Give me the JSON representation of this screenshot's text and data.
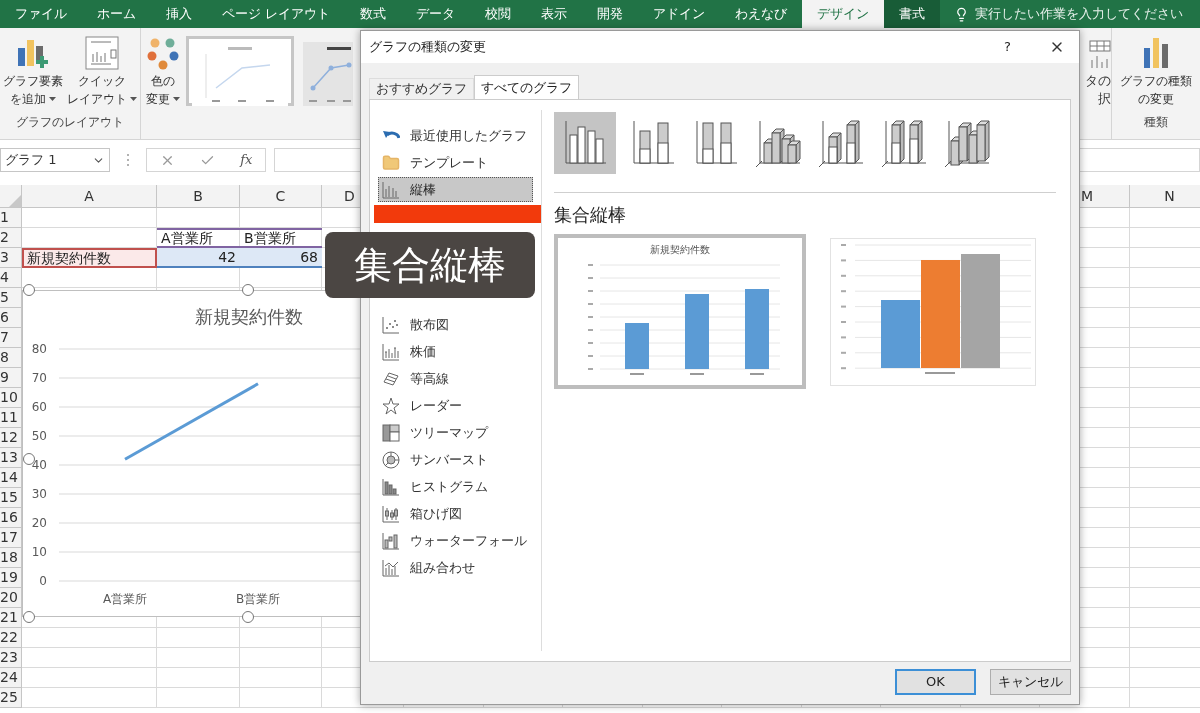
{
  "ribbon_tabs": [
    {
      "label": "ファイル",
      "kind": "normal",
      "selected": false
    },
    {
      "label": "ホーム",
      "kind": "normal",
      "selected": false
    },
    {
      "label": "挿入",
      "kind": "normal",
      "selected": false
    },
    {
      "label": "ページ レイアウト",
      "kind": "normal",
      "selected": false
    },
    {
      "label": "数式",
      "kind": "normal",
      "selected": false
    },
    {
      "label": "データ",
      "kind": "normal",
      "selected": false
    },
    {
      "label": "校閲",
      "kind": "normal",
      "selected": false
    },
    {
      "label": "表示",
      "kind": "normal",
      "selected": false
    },
    {
      "label": "開発",
      "kind": "normal",
      "selected": false
    },
    {
      "label": "アドイン",
      "kind": "normal",
      "selected": false
    },
    {
      "label": "わえなび",
      "kind": "normal",
      "selected": false
    },
    {
      "label": "デザイン",
      "kind": "contextual",
      "selected": true
    },
    {
      "label": "書式",
      "kind": "contextual",
      "selected": false
    }
  ],
  "tell_me": {
    "placeholder": "実行したい作業を入力してください"
  },
  "ribbon": {
    "add_chart_element": [
      "グラフ要素",
      "を追加"
    ],
    "quick_layout": [
      "クイック",
      "レイアウト"
    ],
    "layout_group_label": "グラフのレイアウト",
    "change_colors": [
      "色の",
      "変更"
    ],
    "chart_styles": [
      {
        "selected": true
      },
      {
        "selected": false
      }
    ],
    "select_data": [
      "タの",
      "択"
    ],
    "change_chart_type": [
      "グラフの種類",
      "の変更"
    ],
    "type_group_label": "種類"
  },
  "formula_bar": {
    "name_box": "グラフ 1",
    "function_label": "fx"
  },
  "sheet": {
    "columns_left": [
      "A",
      "B",
      "C",
      "D"
    ],
    "columns_right": [
      "M",
      "N"
    ],
    "row_numbers": [
      "1",
      "2",
      "3",
      "4",
      "5",
      "6",
      "7",
      "8",
      "9",
      "10",
      "11",
      "12",
      "13",
      "14",
      "15",
      "16",
      "17",
      "18",
      "19",
      "20",
      "21",
      "22",
      "23",
      "24",
      "25"
    ],
    "header_row": [
      "A営業所",
      "B営業所"
    ],
    "data_row": {
      "label": "新規契約件数",
      "values": [
        "42",
        "68"
      ]
    },
    "chart": {
      "chart_data": {
        "type": "line",
        "title": "新規契約件数",
        "grid": true,
        "categories": [
          "A営業所",
          "B営業所"
        ],
        "series": [
          {
            "color": "#5b9bd5",
            "values": [
              42,
              68
            ]
          }
        ],
        "ylim": [
          0,
          80
        ],
        "yticks": [
          0,
          10,
          20,
          30,
          40,
          50,
          60,
          70,
          80
        ]
      }
    }
  },
  "dialog": {
    "title": "グラフの種類の変更",
    "help": "?",
    "tabs": [
      {
        "label": "おすすめグラフ",
        "selected": false
      },
      {
        "label": "すべてのグラフ",
        "selected": true
      }
    ],
    "chart_types_upper": [
      {
        "label": "最近使用したグラフ",
        "kind": "recent",
        "selected": false
      },
      {
        "label": "テンプレート",
        "kind": "template",
        "selected": false
      },
      {
        "label": "縦棒",
        "kind": "column",
        "selected": true
      }
    ],
    "chart_types_lower": [
      {
        "label": "散布図",
        "kind": "scatter",
        "selected": false
      },
      {
        "label": "株価",
        "kind": "stock",
        "selected": false
      },
      {
        "label": "等高線",
        "kind": "surface",
        "selected": false
      },
      {
        "label": "レーダー",
        "kind": "radar",
        "selected": false
      },
      {
        "label": "ツリーマップ",
        "kind": "treemap",
        "selected": false
      },
      {
        "label": "サンバースト",
        "kind": "sunburst",
        "selected": false
      },
      {
        "label": "ヒストグラム",
        "kind": "histogram",
        "selected": false
      },
      {
        "label": "箱ひげ図",
        "kind": "boxplot",
        "selected": false
      },
      {
        "label": "ウォーターフォール",
        "kind": "waterfall",
        "selected": false
      },
      {
        "label": "組み合わせ",
        "kind": "combo",
        "selected": false
      }
    ],
    "subtypes": [
      {
        "kind": "clustered",
        "selected": true
      },
      {
        "kind": "stacked",
        "selected": false
      },
      {
        "kind": "stacked100",
        "selected": false
      },
      {
        "kind": "clustered3d",
        "selected": false
      },
      {
        "kind": "stacked3d",
        "selected": false
      },
      {
        "kind": "stacked100_3d",
        "selected": false
      },
      {
        "kind": "column3d",
        "selected": false
      }
    ],
    "subtype_heading": "集合縦棒",
    "previews": [
      {
        "kind": "by_category",
        "title": "新規契約件数",
        "selected": true
      },
      {
        "kind": "by_series",
        "selected": false
      }
    ],
    "buttons": [
      {
        "label": "OK",
        "default": true
      },
      {
        "label": "キャンセル",
        "default": false
      }
    ]
  },
  "caption_overlay": {
    "text": "集合縦棒"
  }
}
